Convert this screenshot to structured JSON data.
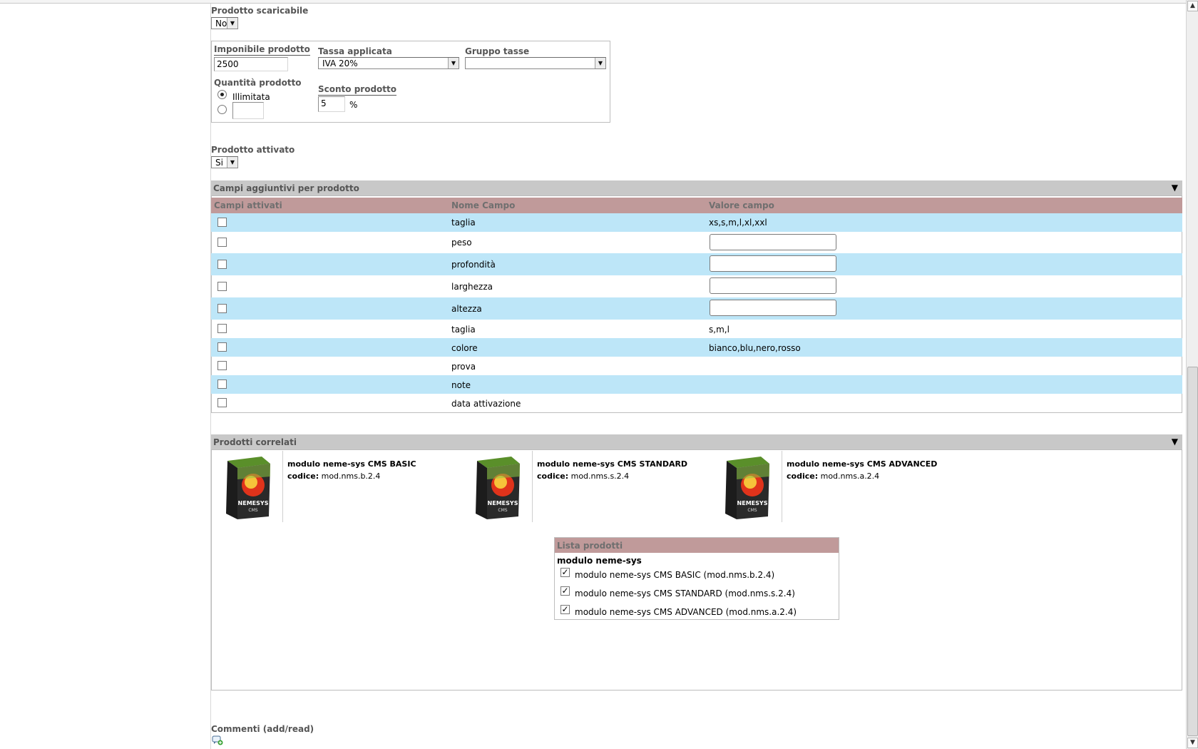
{
  "form": {
    "downloadable_label": "Prodotto scaricabile",
    "downloadable_value": "No",
    "taxable_label": "Imponibile prodotto",
    "taxable_value": "2500",
    "tax_label": "Tassa applicata",
    "tax_value": "IVA 20%",
    "tax_group_label": "Gruppo tasse",
    "tax_group_value": "",
    "quantity_label": "Quantità prodotto",
    "quantity_unlimited": "Illimitata",
    "discount_label": "Sconto prodotto",
    "discount_value": "5",
    "discount_unit": "%",
    "active_label": "Prodotto attivato",
    "active_value": "Si"
  },
  "extra_fields": {
    "title": "Campi aggiuntivi per prodotto",
    "columns": [
      "Campi attivati",
      "Nome Campo",
      "Valore campo"
    ],
    "rows": [
      {
        "name": "taglia",
        "value": "xs,s,m,l,xl,xxl"
      },
      {
        "name": "peso",
        "value": ""
      },
      {
        "name": "profondità",
        "value": ""
      },
      {
        "name": "larghezza",
        "value": ""
      },
      {
        "name": "altezza",
        "value": ""
      },
      {
        "name": "taglia",
        "value": "s,m,l"
      },
      {
        "name": "colore",
        "value": "bianco,blu,nero,rosso"
      },
      {
        "name": "prova",
        "value": ""
      },
      {
        "name": "note",
        "value": ""
      },
      {
        "name": "data attivazione",
        "value": ""
      }
    ]
  },
  "related": {
    "title": "Prodotti correlati",
    "code_label": "codice:",
    "products": [
      {
        "name": "modulo neme-sys CMS BASIC",
        "code": "mod.nms.b.2.4"
      },
      {
        "name": "modulo neme-sys CMS STANDARD",
        "code": "mod.nms.s.2.4"
      },
      {
        "name": "modulo neme-sys CMS ADVANCED",
        "code": "mod.nms.a.2.4"
      }
    ],
    "thumb_text": "NEMESYS",
    "thumb_sub": "CMS"
  },
  "product_list": {
    "title": "Lista prodotti",
    "group": "modulo neme-sys",
    "items": [
      "modulo neme-sys CMS BASIC (mod.nms.b.2.4)",
      "modulo neme-sys CMS STANDARD (mod.nms.s.2.4)",
      "modulo neme-sys CMS ADVANCED (mod.nms.a.2.4)"
    ]
  },
  "comments": {
    "label": "Commenti (add/read)"
  },
  "icons": {
    "collapse": "collapse-triangle-icon",
    "comment": "comment-add-icon",
    "checkmark": "✓"
  }
}
